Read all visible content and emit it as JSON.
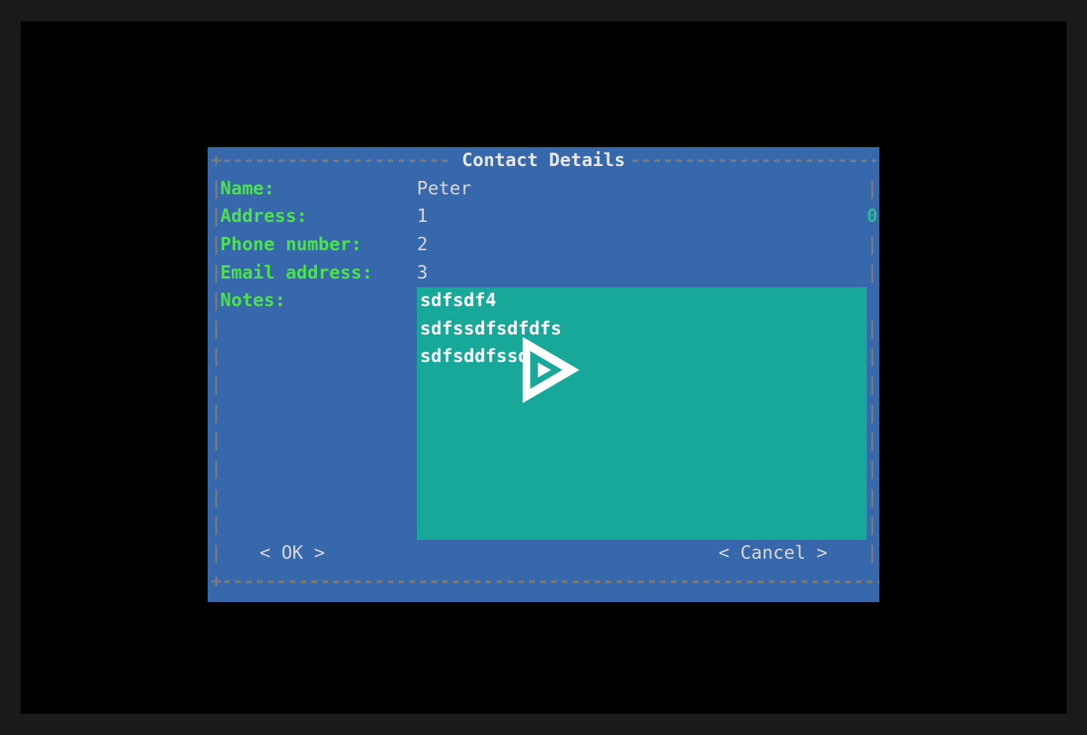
{
  "dialog": {
    "title": "Contact Details",
    "fields": {
      "name_label": "Name:",
      "name_value": "Peter",
      "address_label": "Address:",
      "address_value": "1",
      "address_indicator": "0",
      "phone_label": "Phone number:",
      "phone_value": "2",
      "email_label": "Email address:",
      "email_value": "3",
      "notes_label": "Notes:",
      "notes_value": "sdfsdf4\nsdfssdfsdfdfs\nsdfsddfssds"
    },
    "buttons": {
      "ok_label": "< OK >",
      "cancel_label": "< Cancel >"
    }
  },
  "overlay": {
    "play_name": "play"
  }
}
